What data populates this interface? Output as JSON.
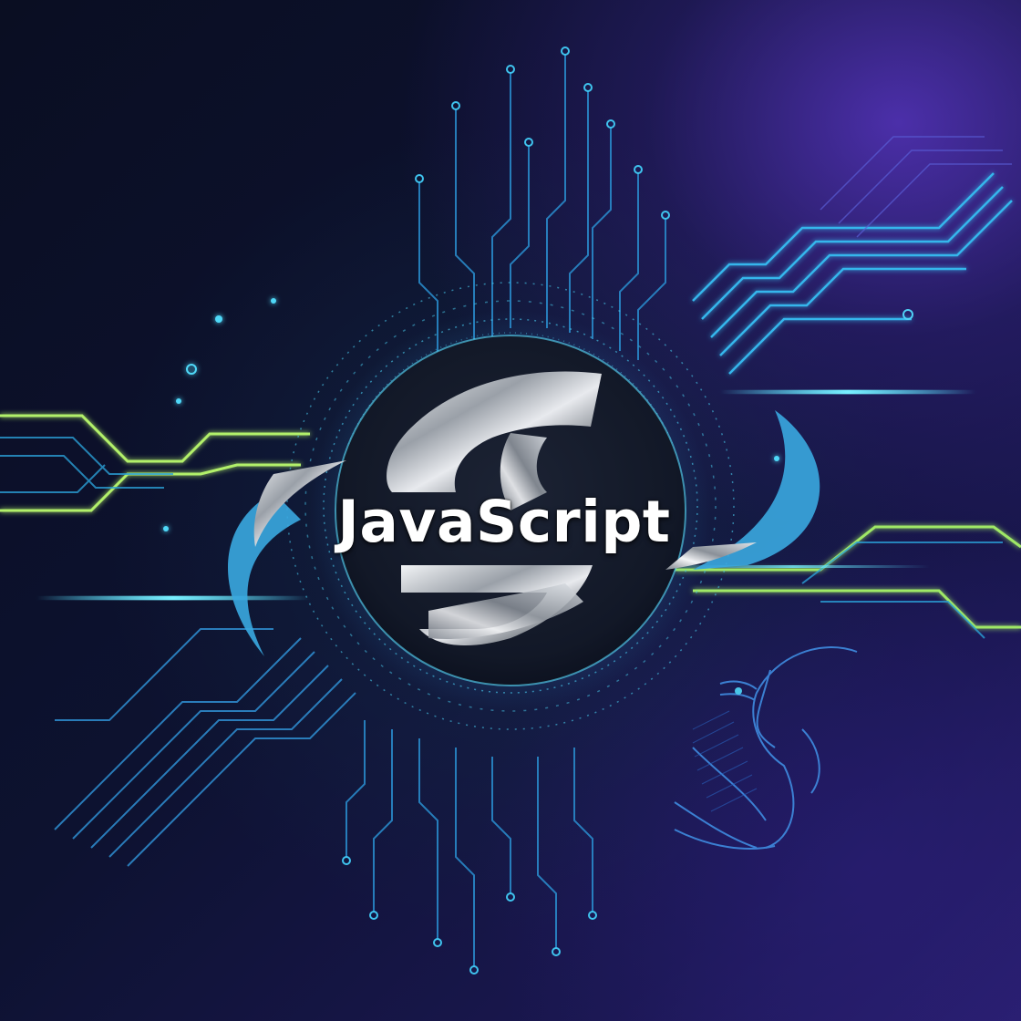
{
  "logo": {
    "text": "JavaScript"
  },
  "colors": {
    "background_dark": "#0b0f24",
    "background_purple": "#3a2a8f",
    "circuit_cyan": "#2fc8e8",
    "circuit_blue": "#2a7fd8",
    "circuit_green": "#a8f060",
    "emblem_disc": "#141a2c",
    "emblem_metal": "#c8ccd2",
    "glow": "#5ae0ff"
  },
  "icons": [
    "circuit-traces",
    "metallic-s-emblem",
    "cyber-face-outline"
  ]
}
